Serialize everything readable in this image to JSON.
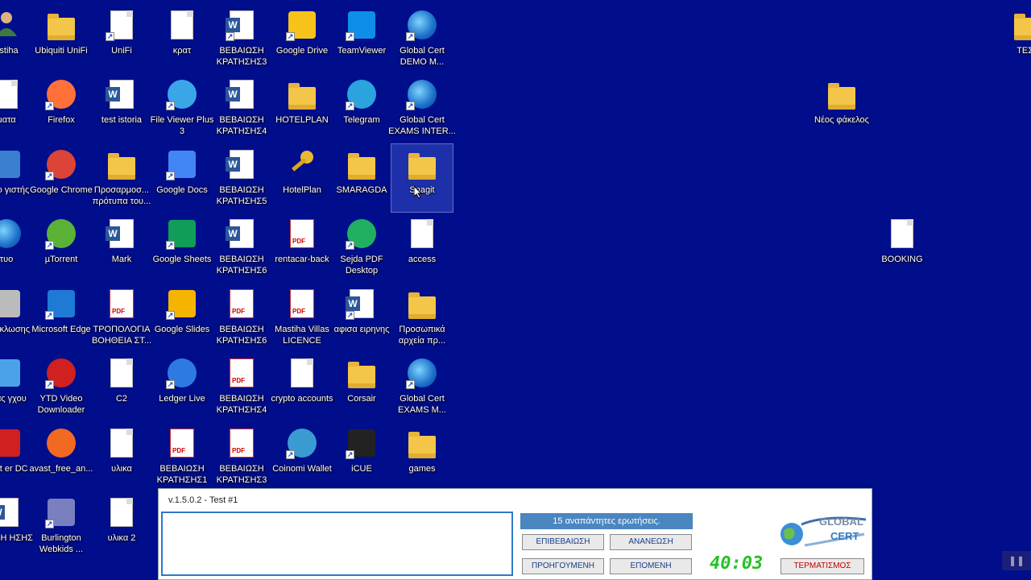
{
  "desktop": {
    "icons": [
      {
        "label": "astiha",
        "type": "person",
        "color": "#e09a3a"
      },
      {
        "label": "Ubiquiti UniFi",
        "type": "folder"
      },
      {
        "label": "UniFi",
        "type": "doc",
        "shortcut": true
      },
      {
        "label": "κρατ",
        "type": "doc"
      },
      {
        "label": "ΒΕΒΑΙΩΣΗ ΚΡΑΤΗΣΗΣ3",
        "type": "word",
        "shortcut": true
      },
      {
        "label": "Google Drive",
        "type": "square",
        "color": "#f6c31b",
        "shortcut": true
      },
      {
        "label": "TeamViewer",
        "type": "square",
        "color": "#0e8ee9",
        "shortcut": true
      },
      {
        "label": "Global Cert DEMO M...",
        "type": "globe",
        "shortcut": true
      },
      {
        "label": "ματα",
        "type": "doc"
      },
      {
        "label": "Firefox",
        "type": "circle",
        "color": "#ff7139",
        "shortcut": true
      },
      {
        "label": "test istoria",
        "type": "word"
      },
      {
        "label": "File Viewer Plus 3",
        "type": "circle",
        "color": "#3aa6e8",
        "shortcut": true
      },
      {
        "label": "ΒΕΒΑΙΩΣΗ ΚΡΑΤΗΣΗΣ4",
        "type": "word"
      },
      {
        "label": "HOTELPLAN",
        "type": "folder"
      },
      {
        "label": "Telegram",
        "type": "circle",
        "color": "#2aa3df",
        "shortcut": true
      },
      {
        "label": "Global Cert EXAMS INTER...",
        "type": "globe",
        "shortcut": true
      },
      {
        "label": "ιός ο γιστής",
        "type": "square",
        "color": "#3a7fd0"
      },
      {
        "label": "Google Chrome",
        "type": "circle",
        "color": "#db4437",
        "shortcut": true
      },
      {
        "label": "Προσαρμοσ... πρότυπα του...",
        "type": "folder"
      },
      {
        "label": "Google Docs",
        "type": "square",
        "color": "#4285f4",
        "shortcut": true
      },
      {
        "label": "ΒΕΒΑΙΩΣΗ ΚΡΑΤΗΣΗΣ5",
        "type": "word"
      },
      {
        "label": "HotelPlan",
        "type": "key"
      },
      {
        "label": "SMARAGDA",
        "type": "folder"
      },
      {
        "label": "Snagit",
        "type": "folder",
        "selected": true
      },
      {
        "label": "τυο",
        "type": "globe"
      },
      {
        "label": "µTorrent",
        "type": "circle",
        "color": "#5ab336",
        "shortcut": true
      },
      {
        "label": "Mark",
        "type": "word"
      },
      {
        "label": "Google Sheets",
        "type": "square",
        "color": "#0f9d58",
        "shortcut": true
      },
      {
        "label": "ΒΕΒΑΙΩΣΗ ΚΡΑΤΗΣΗΣ6",
        "type": "word"
      },
      {
        "label": "rentacar-back",
        "type": "pdf"
      },
      {
        "label": "Sejda PDF Desktop",
        "type": "circle",
        "color": "#21b062",
        "shortcut": true
      },
      {
        "label": "access",
        "type": "doc"
      },
      {
        "label": "δος κλωσης",
        "type": "square",
        "color": "#bbb"
      },
      {
        "label": "Microsoft Edge",
        "type": "square",
        "color": "#1f7ad6",
        "shortcut": true
      },
      {
        "label": "ΤΡΟΠΟΛΟΓΙΑ ΒΟΗΘΕΙΑ ΣΤ...",
        "type": "pdf"
      },
      {
        "label": "Google Slides",
        "type": "square",
        "color": "#f4b400",
        "shortcut": true
      },
      {
        "label": "ΒΕΒΑΙΩΣΗ ΚΡΑΤΗΣΗΣ6",
        "type": "pdf"
      },
      {
        "label": "Mastiha Villas LICENCE",
        "type": "pdf"
      },
      {
        "label": "αφισα ειρηνης",
        "type": "word",
        "shortcut": true
      },
      {
        "label": "Προσωπικά αρχεία πρ...",
        "type": "folder"
      },
      {
        "label": "ακας γχου",
        "type": "square",
        "color": "#4aa3e8"
      },
      {
        "label": "YTD Video Downloader",
        "type": "circle",
        "color": "#d02020",
        "shortcut": true
      },
      {
        "label": "C2",
        "type": "doc"
      },
      {
        "label": "Ledger Live",
        "type": "circle",
        "color": "#2d7be0",
        "shortcut": true
      },
      {
        "label": "ΒΕΒΑΙΩΣΗ ΚΡΑΤΗΣΗΣ4",
        "type": "pdf"
      },
      {
        "label": "crypto accounts",
        "type": "doc"
      },
      {
        "label": "Corsair",
        "type": "folder"
      },
      {
        "label": "Global Cert EXAMS M...",
        "type": "globe",
        "shortcut": true
      },
      {
        "label": "obat er DC",
        "type": "square",
        "color": "#d02020"
      },
      {
        "label": "avast_free_an...",
        "type": "circle",
        "color": "#f26a22"
      },
      {
        "label": "υλικα",
        "type": "doc"
      },
      {
        "label": "ΒΕΒΑΙΩΣΗ ΚΡΑΤΗΣΗΣ1",
        "type": "pdf"
      },
      {
        "label": "ΒΕΒΑΙΩΣΗ ΚΡΑΤΗΣΗΣ3",
        "type": "pdf"
      },
      {
        "label": "Coinomi Wallet",
        "type": "circle",
        "color": "#3a9bd0",
        "shortcut": true
      },
      {
        "label": "iCUE",
        "type": "square",
        "color": "#222",
        "shortcut": true
      },
      {
        "label": "games",
        "type": "folder"
      },
      {
        "label": "ΑΙΩΣΗ ΗΣΗΣ",
        "type": "word"
      },
      {
        "label": "Burlington Webkids ...",
        "type": "square",
        "color": "#7a7fc0",
        "shortcut": true
      },
      {
        "label": "υλικα 2",
        "type": "doc"
      },
      {
        "label": "Νέος φάκελος",
        "type": "folder"
      },
      {
        "label": "BOOKING",
        "type": "doc"
      },
      {
        "label": "ΤΕΣΤ",
        "type": "folder"
      }
    ]
  },
  "dialog": {
    "title": "v.1.5.0.2 - Test #1",
    "unanswered": "15 αναπάντητες ερωτήσεις.",
    "confirm_label": "ΕΠΙΒΕΒΑΙΩΣΗ",
    "refresh_label": "ΑΝΑΝΕΩΣΗ",
    "previous_label": "ΠΡΟΗΓΟΥΜΕΝΗ",
    "next_label": "ΕΠΟΜΕΝΗ",
    "finish_label": "ΤΕΡΜΑΤΙΣΜΟΣ",
    "timer": "40:03",
    "logo_line1": "GLOBAL",
    "logo_line2": "CERT"
  },
  "overlay": {
    "pause_symbol": "❚❚"
  }
}
